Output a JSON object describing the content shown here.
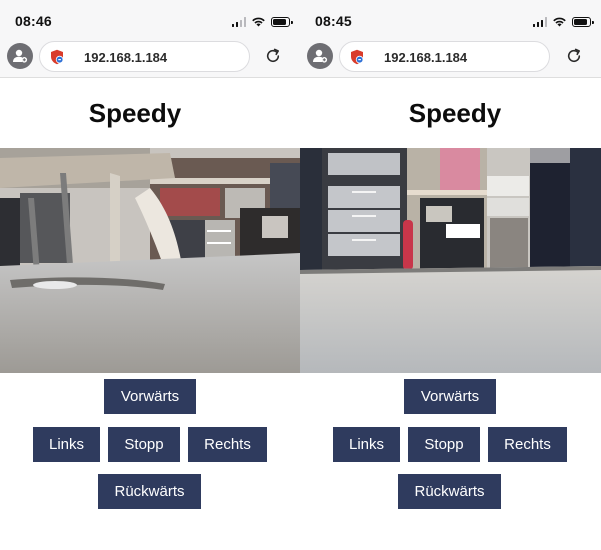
{
  "phones": [
    {
      "time": "08:46",
      "url": "192.168.1.184",
      "page_title": "Speedy",
      "buttons": {
        "forward": "Vorwärts",
        "left": "Links",
        "stop": "Stopp",
        "right": "Rechts",
        "backward": "Rückwärts"
      },
      "camera_scene": "chair-legs-on-floor"
    },
    {
      "time": "08:45",
      "url": "192.168.1.184",
      "page_title": "Speedy",
      "buttons": {
        "forward": "Vorwärts",
        "left": "Links",
        "stop": "Stopp",
        "right": "Rechts",
        "backward": "Rückwärts"
      },
      "camera_scene": "cabinets-and-extinguisher"
    }
  ],
  "icons": {
    "profile": "person-circle-icon",
    "site_security": "shield-icon",
    "reload": "reload-icon",
    "cellular": "signal-icon",
    "wifi": "wifi-icon",
    "battery": "battery-icon"
  },
  "colors": {
    "button_bg": "#2f3b5e",
    "button_text": "#ffffff",
    "chrome_bg": "#f7f7f8",
    "avatar_bg": "#6e6e73",
    "shield_red": "#d93b2b",
    "shield_blue": "#2d6fd6"
  }
}
